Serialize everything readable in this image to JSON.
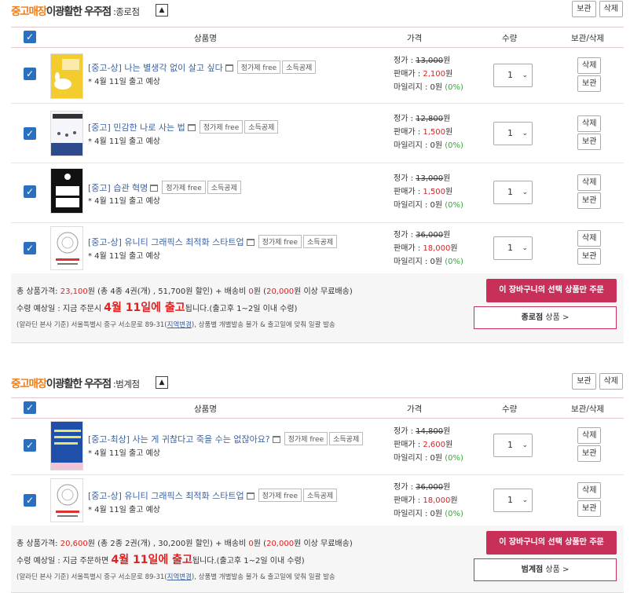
{
  "sections": [
    {
      "brand_orange": "중고매장",
      "brand_name": "이광활한 우주점",
      "store_suffix": ":종로점",
      "toggle": "▲",
      "keep_btn": "보관",
      "delete_btn": "삭제",
      "headers": {
        "name": "상품명",
        "price": "가격",
        "qty": "수량",
        "action": "보관/삭제"
      },
      "items": [
        {
          "title": "[중고-상] 나는 별생각 없이 살고 싶다",
          "tag1": "정가제 free",
          "tag2": "소득공제",
          "ship": "* 4월 11일 출고 예상",
          "list_label": "정가 : ",
          "list_price": "13,000",
          "sale_label": "판매가 : ",
          "sale_price": "2,100",
          "won": "원",
          "mileage_label": "마일리지 : ",
          "mileage": "0원",
          "mileage_pct": "(0%)",
          "qty": "1",
          "del": "삭제",
          "keep": "보관",
          "cover": "yellow"
        },
        {
          "title": "[중고] 민감한 나로 사는 법",
          "tag1": "정가제 free",
          "tag2": "소득공제",
          "ship": "* 4월 11일 출고 예상",
          "list_label": "정가 : ",
          "list_price": "12,800",
          "sale_label": "판매가 : ",
          "sale_price": "1,500",
          "won": "원",
          "mileage_label": "마일리지 : ",
          "mileage": "0원",
          "mileage_pct": "(0%)",
          "qty": "1",
          "del": "삭제",
          "keep": "보관",
          "cover": "blue"
        },
        {
          "title": "[중고] 습관 혁명",
          "tag1": "정가제 free",
          "tag2": "소득공제",
          "ship": "* 4월 11일 출고 예상",
          "list_label": "정가 : ",
          "list_price": "13,000",
          "sale_label": "판매가 : ",
          "sale_price": "1,500",
          "won": "원",
          "mileage_label": "마일리지 : ",
          "mileage": "0원",
          "mileage_pct": "(0%)",
          "qty": "1",
          "del": "삭제",
          "keep": "보관",
          "cover": "black"
        },
        {
          "title": "[중고-상] 유니티 그래픽스 최적화 스타트업",
          "tag1": "정가제 free",
          "tag2": "소득공제",
          "ship": "* 4월 11일 출고 예상",
          "list_label": "정가 : ",
          "list_price": "36,000",
          "sale_label": "판매가 : ",
          "sale_price": "18,000",
          "won": "원",
          "mileage_label": "마일리지 : ",
          "mileage": "0원",
          "mileage_pct": "(0%)",
          "qty": "1",
          "del": "삭제",
          "keep": "보관",
          "cover": "white"
        }
      ],
      "summary": {
        "l1a": "총 상품가격: ",
        "l1_total": "23,100",
        "l1b": "원 (총 4종 4권(개) , 51,700원 할인) + 배송비 ",
        "l1_ship": "0",
        "l1c": "원 (",
        "l1_free": "20,000",
        "l1d": "원 이상 무료배송)",
        "l2a": "수령 예상일 : 지금 주문시 ",
        "l2_big": "4월 11일에 출고",
        "l2b": "됩니다.(출고후 1~2일 이내 수령)",
        "l3a": "(알라딘 본사 기준) 서울특별시 중구 서소문로 89-31(",
        "l3_link": "지역변경",
        "l3b": "), 상품별 개별발송 불가 & 출고일에 맞춰 일괄 발송",
        "order_btn": "이 장바구니의 선택 상품만 주문",
        "store_name": "종로점",
        "store_rest": " 상품 >"
      }
    },
    {
      "brand_orange": "중고매장",
      "brand_name": "이광활한 우주점",
      "store_suffix": ":범계점",
      "toggle": "▲",
      "keep_btn": "보관",
      "delete_btn": "삭제",
      "headers": {
        "name": "상품명",
        "price": "가격",
        "qty": "수량",
        "action": "보관/삭제"
      },
      "items": [
        {
          "title": "[중고-최상] 사는 게 귀찮다고 죽을 수는 없잖아요?",
          "tag1": "정가제 free",
          "tag2": "소득공제",
          "ship": "* 4월 11일 출고 예상",
          "list_label": "정가 : ",
          "list_price": "14,800",
          "sale_label": "판매가 : ",
          "sale_price": "2,600",
          "won": "원",
          "mileage_label": "마일리지 : ",
          "mileage": "0원",
          "mileage_pct": "(0%)",
          "qty": "1",
          "del": "삭제",
          "keep": "보관",
          "cover": "navy"
        },
        {
          "title": "[중고-상] 유니티 그래픽스 최적화 스타트업",
          "tag1": "정가제 free",
          "tag2": "소득공제",
          "ship": "* 4월 11일 출고 예상",
          "list_label": "정가 : ",
          "list_price": "36,000",
          "sale_label": "판매가 : ",
          "sale_price": "18,000",
          "won": "원",
          "mileage_label": "마일리지 : ",
          "mileage": "0원",
          "mileage_pct": "(0%)",
          "qty": "1",
          "del": "삭제",
          "keep": "보관",
          "cover": "white"
        }
      ],
      "summary": {
        "l1a": "총 상품가격: ",
        "l1_total": "20,600",
        "l1b": "원 (총 2종 2권(개) , 30,200원 할인) + 배송비 ",
        "l1_ship": "0",
        "l1c": "원 (",
        "l1_free": "20,000",
        "l1d": "원 이상 무료배송)",
        "l2a": "수령 예상일 : 지금 주문하면 ",
        "l2_big": "4월 11일에 출고",
        "l2b": "됩니다.(출고후 1~2일 이내 수령)",
        "l3a": "(알라딘 본사 기준) 서울특별시 중구 서소문로 89-31(",
        "l3_link": "지역변경",
        "l3b": "), 상품별 개별발송 불가 & 출고일에 맞춰 일괄 발송",
        "order_btn": "이 장바구니의 선택 상품만 주문",
        "store_name": "범계점",
        "store_rest": " 상품 >"
      }
    }
  ],
  "colors": {
    "accent": "#f07d16",
    "order": "#c8305a",
    "link": "#3c62a0",
    "price_red": "#dd2222",
    "check_blue": "#2b6fbf"
  }
}
